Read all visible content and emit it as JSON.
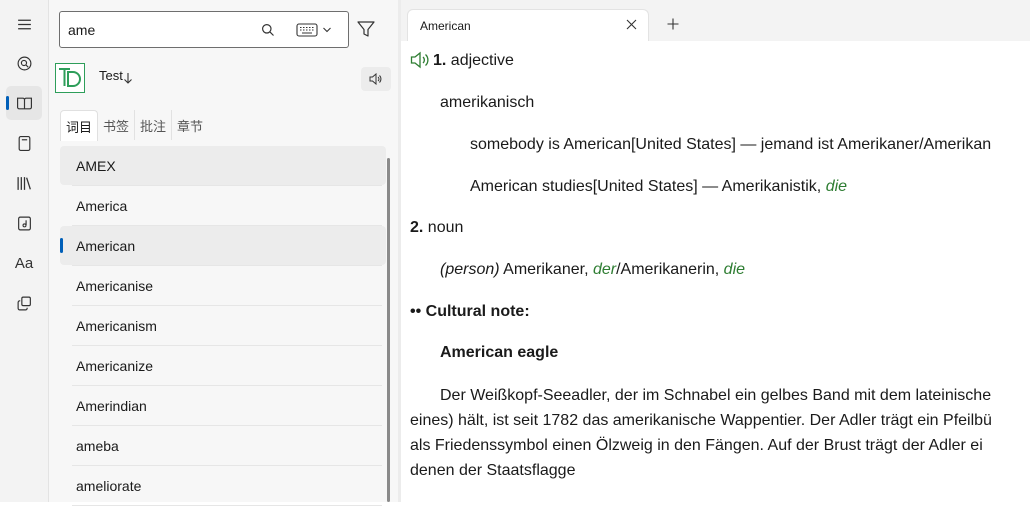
{
  "rail": {
    "items": [
      {
        "icon": "menu-icon"
      },
      {
        "icon": "search-dictionary-icon"
      },
      {
        "icon": "book-open-icon",
        "active": true
      },
      {
        "icon": "notebook-icon"
      },
      {
        "icon": "library-icon"
      },
      {
        "icon": "music-book-icon"
      },
      {
        "icon": "font-icon",
        "label": "Aa"
      },
      {
        "icon": "copy-icon"
      }
    ]
  },
  "search": {
    "value": "ame",
    "placeholder": ""
  },
  "dictionary": {
    "name": "Test"
  },
  "tabs": [
    "词目",
    "书签",
    "批注",
    "章节"
  ],
  "words": [
    "AMEX",
    "America",
    "American",
    "Americanise",
    "Americanism",
    "Americanize",
    "Amerindian",
    "ameba",
    "ameliorate"
  ],
  "selected_word": "American",
  "doc_tab": {
    "title": "American"
  },
  "entry": {
    "sense1": {
      "num": "1.",
      "pos": "adjective"
    },
    "translation1": "amerikanisch",
    "ex1": {
      "text": "somebody is American[United States] — jemand ist Amerikaner/Amerikan"
    },
    "ex2": {
      "text": "American studies[United States] — Amerikanistik, ",
      "gender": "die"
    },
    "sense2": {
      "num": "2.",
      "pos": "noun"
    },
    "noun_line": {
      "label": "(person)",
      "t1": " Amerikaner, ",
      "g1": "der",
      "t2": "/Amerikanerin, ",
      "g2": "die"
    },
    "note_marker": "••",
    "note_title": "Cultural note:",
    "note_heading": "American eagle",
    "note_lines": [
      "Der Weißkopf-Seeadler, der im Schnabel ein gelbes Band mit dem lateinische",
      "eines) hält, ist seit 1782 das amerikanische Wappentier. Der Adler trägt ein Pfeilbü",
      "als Friedenssymbol einen Ölzweig in den Fängen. Auf der Brust trägt der Adler ei",
      "denen der Staatsflagge"
    ]
  },
  "colors": {
    "accent": "#005fb8",
    "gender": "#2e7d32",
    "speaker": "#2e7d32"
  }
}
